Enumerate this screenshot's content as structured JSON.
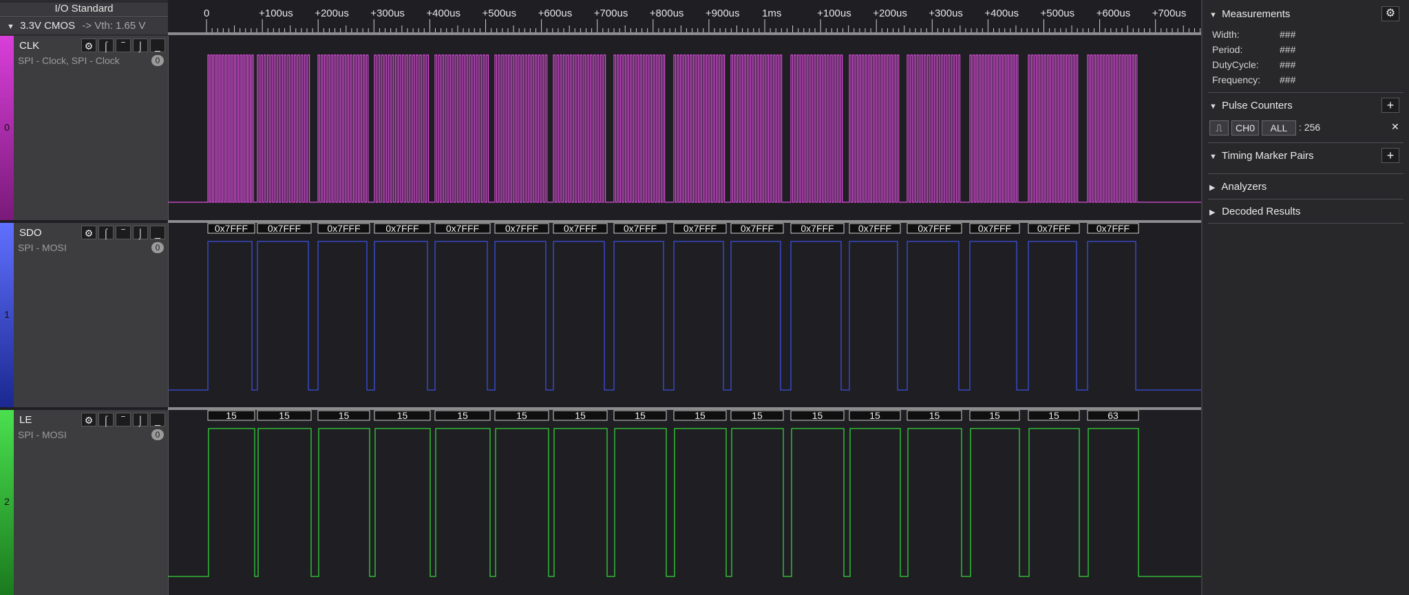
{
  "io_standard": {
    "title": "I/O Standard",
    "expand_glyph": "▼",
    "standard": "3.3V CMOS",
    "vth": "-> Vth: 1.65 V"
  },
  "ruler": {
    "labels": [
      "0",
      "+100us",
      "+200us",
      "+300us",
      "+400us",
      "+500us",
      "+600us",
      "+700us",
      "+800us",
      "+900us",
      "1ms",
      "+100us",
      "+200us",
      "+300us",
      "+400us",
      "+500us",
      "+600us",
      "+700us"
    ]
  },
  "channels": [
    {
      "index": "0",
      "name": "CLK",
      "subtitle": "SPI - Clock, SPI - Clock",
      "count": "0",
      "color": "#e24ee2",
      "strip_top": "#d93fd9",
      "strip_bottom": "#7a1a7a",
      "tools": [
        "⚙",
        "⌠",
        "‾",
        "⌡",
        "_"
      ],
      "decode": []
    },
    {
      "index": "1",
      "name": "SDO",
      "subtitle": "SPI - MOSI",
      "count": "0",
      "color": "#3a4fe0",
      "strip_top": "#6070ff",
      "strip_bottom": "#1a2890",
      "tools": [
        "⚙",
        "⌠",
        "‾",
        "⌡",
        "_"
      ],
      "decode": [
        "0x7FFF",
        "0x7FFF",
        "0x7FFF",
        "0x7FFF",
        "0x7FFF",
        "0x7FFF",
        "0x7FFF",
        "0x7FFF",
        "0x7FFF",
        "0x7FFF",
        "0x7FFF",
        "0x7FFF",
        "0x7FFF",
        "0x7FFF",
        "0x7FFF",
        "0x7FFF"
      ]
    },
    {
      "index": "2",
      "name": "LE",
      "subtitle": "SPI - MOSI",
      "count": "0",
      "color": "#34d33a",
      "strip_top": "#4ae04f",
      "strip_bottom": "#1a7a1e",
      "tools": [
        "⚙",
        "⌠",
        "‾",
        "⌡",
        "_"
      ],
      "decode": [
        "15",
        "15",
        "15",
        "15",
        "15",
        "15",
        "15",
        "15",
        "15",
        "15",
        "15",
        "15",
        "15",
        "15",
        "15",
        "63"
      ]
    }
  ],
  "right_panel": {
    "measurements": {
      "title": "Measurements",
      "rows": [
        {
          "label": "Width:",
          "value": "###"
        },
        {
          "label": "Period:",
          "value": "###"
        },
        {
          "label": "DutyCycle:",
          "value": "###"
        },
        {
          "label": "Frequency:",
          "value": "###"
        }
      ]
    },
    "pulse_counters": {
      "title": "Pulse Counters",
      "edge_glyph": "⎍",
      "channel": "CH0",
      "range": "ALL",
      "count": ": 256",
      "remove": "✕"
    },
    "timing_marker_pairs": {
      "title": "Timing Marker Pairs"
    },
    "analyzers": {
      "title": "Analyzers"
    },
    "decoded_results": {
      "title": "Decoded Results"
    },
    "expand_down": "▼",
    "expand_right": "▶",
    "add_glyph": "+",
    "gear_glyph": "⚙"
  }
}
